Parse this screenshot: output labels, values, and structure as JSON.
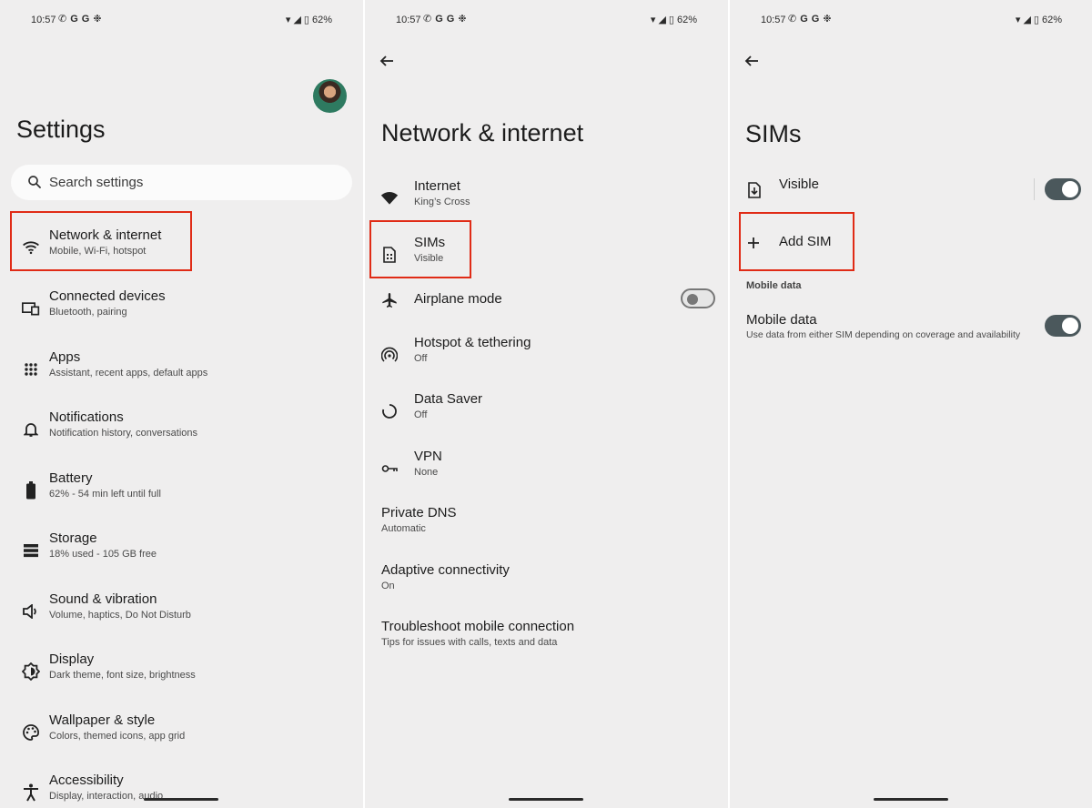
{
  "status": {
    "time": "10:57",
    "left_icons": [
      "call-icon",
      "G",
      "G",
      "vpn-icon"
    ],
    "battery": "62%"
  },
  "colors": {
    "highlight": "#e02b16",
    "toggle_on": "#4b585c",
    "panel_bg": "#efeeee"
  },
  "settings": {
    "title": "Settings",
    "search_placeholder": "Search settings",
    "items": [
      {
        "label": "Network & internet",
        "sub": "Mobile, Wi-Fi, hotspot",
        "icon": "wifi-icon"
      },
      {
        "label": "Connected devices",
        "sub": "Bluetooth, pairing",
        "icon": "devices-icon"
      },
      {
        "label": "Apps",
        "sub": "Assistant, recent apps, default apps",
        "icon": "apps-grid-icon"
      },
      {
        "label": "Notifications",
        "sub": "Notification history, conversations",
        "icon": "bell-icon"
      },
      {
        "label": "Battery",
        "sub": "62% - 54 min left until full",
        "icon": "battery-icon"
      },
      {
        "label": "Storage",
        "sub": "18% used - 105 GB free",
        "icon": "storage-icon"
      },
      {
        "label": "Sound & vibration",
        "sub": "Volume, haptics, Do Not Disturb",
        "icon": "volume-icon"
      },
      {
        "label": "Display",
        "sub": "Dark theme, font size, brightness",
        "icon": "display-icon"
      },
      {
        "label": "Wallpaper & style",
        "sub": "Colors, themed icons, app grid",
        "icon": "palette-icon"
      },
      {
        "label": "Accessibility",
        "sub": "Display, interaction, audio",
        "icon": "accessibility-icon"
      }
    ]
  },
  "network": {
    "title": "Network & internet",
    "items": [
      {
        "label": "Internet",
        "sub": "King’s Cross",
        "icon": "wifi-icon"
      },
      {
        "label": "SIMs",
        "sub": "Visible",
        "icon": "sim-icon"
      },
      {
        "label": "Airplane mode",
        "sub": "",
        "icon": "airplane-icon"
      },
      {
        "label": "Hotspot & tethering",
        "sub": "Off",
        "icon": "hotspot-icon"
      },
      {
        "label": "Data Saver",
        "sub": "Off",
        "icon": "data-saver-icon"
      },
      {
        "label": "VPN",
        "sub": "None",
        "icon": "vpn-key-icon"
      },
      {
        "label": "Private DNS",
        "sub": "Automatic",
        "icon": ""
      },
      {
        "label": "Adaptive connectivity",
        "sub": "On",
        "icon": ""
      },
      {
        "label": "Troubleshoot mobile connection",
        "sub": "Tips for issues with calls, texts and data",
        "icon": ""
      }
    ],
    "airplane_mode_on": false
  },
  "sims": {
    "title": "SIMs",
    "sim_label": "Visible",
    "sim_enabled": true,
    "add_sim": "Add SIM",
    "section": "Mobile data",
    "mobile_data_label": "Mobile data",
    "mobile_data_sub": "Use data from either SIM depending on coverage and availability",
    "mobile_data_on": true
  }
}
